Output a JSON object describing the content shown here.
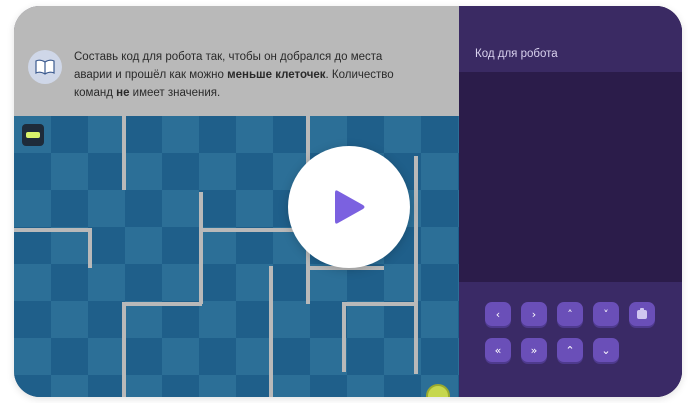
{
  "task": {
    "text_part1": "Составь код для робота так, чтобы он добрался до места аварии и прошёл как можно ",
    "text_bold1": "меньше клеточек",
    "text_part2": ". Количество команд ",
    "text_bold2": "не",
    "text_part3": " имеет значения."
  },
  "code_panel": {
    "title": "Код для робота"
  },
  "controls": {
    "row1": [
      {
        "name": "left",
        "glyph": "‹"
      },
      {
        "name": "right",
        "glyph": "›"
      },
      {
        "name": "up",
        "glyph": "˄"
      },
      {
        "name": "down",
        "glyph": "˅"
      },
      {
        "name": "repair",
        "glyph": "▮"
      }
    ],
    "row2": [
      {
        "name": "left-double",
        "glyph": "«"
      },
      {
        "name": "right-double",
        "glyph": "»"
      },
      {
        "name": "up-double",
        "glyph": "⌃"
      },
      {
        "name": "down-double",
        "glyph": "⌄"
      }
    ]
  },
  "icons": {
    "task": "book-icon",
    "play": "play-icon",
    "robot": "robot-icon",
    "goal": "goal-icon"
  },
  "colors": {
    "accent": "#6a4fb8",
    "play_triangle": "#7b61e0",
    "panel": "#2e1f4f",
    "board": "#2c6f97"
  }
}
